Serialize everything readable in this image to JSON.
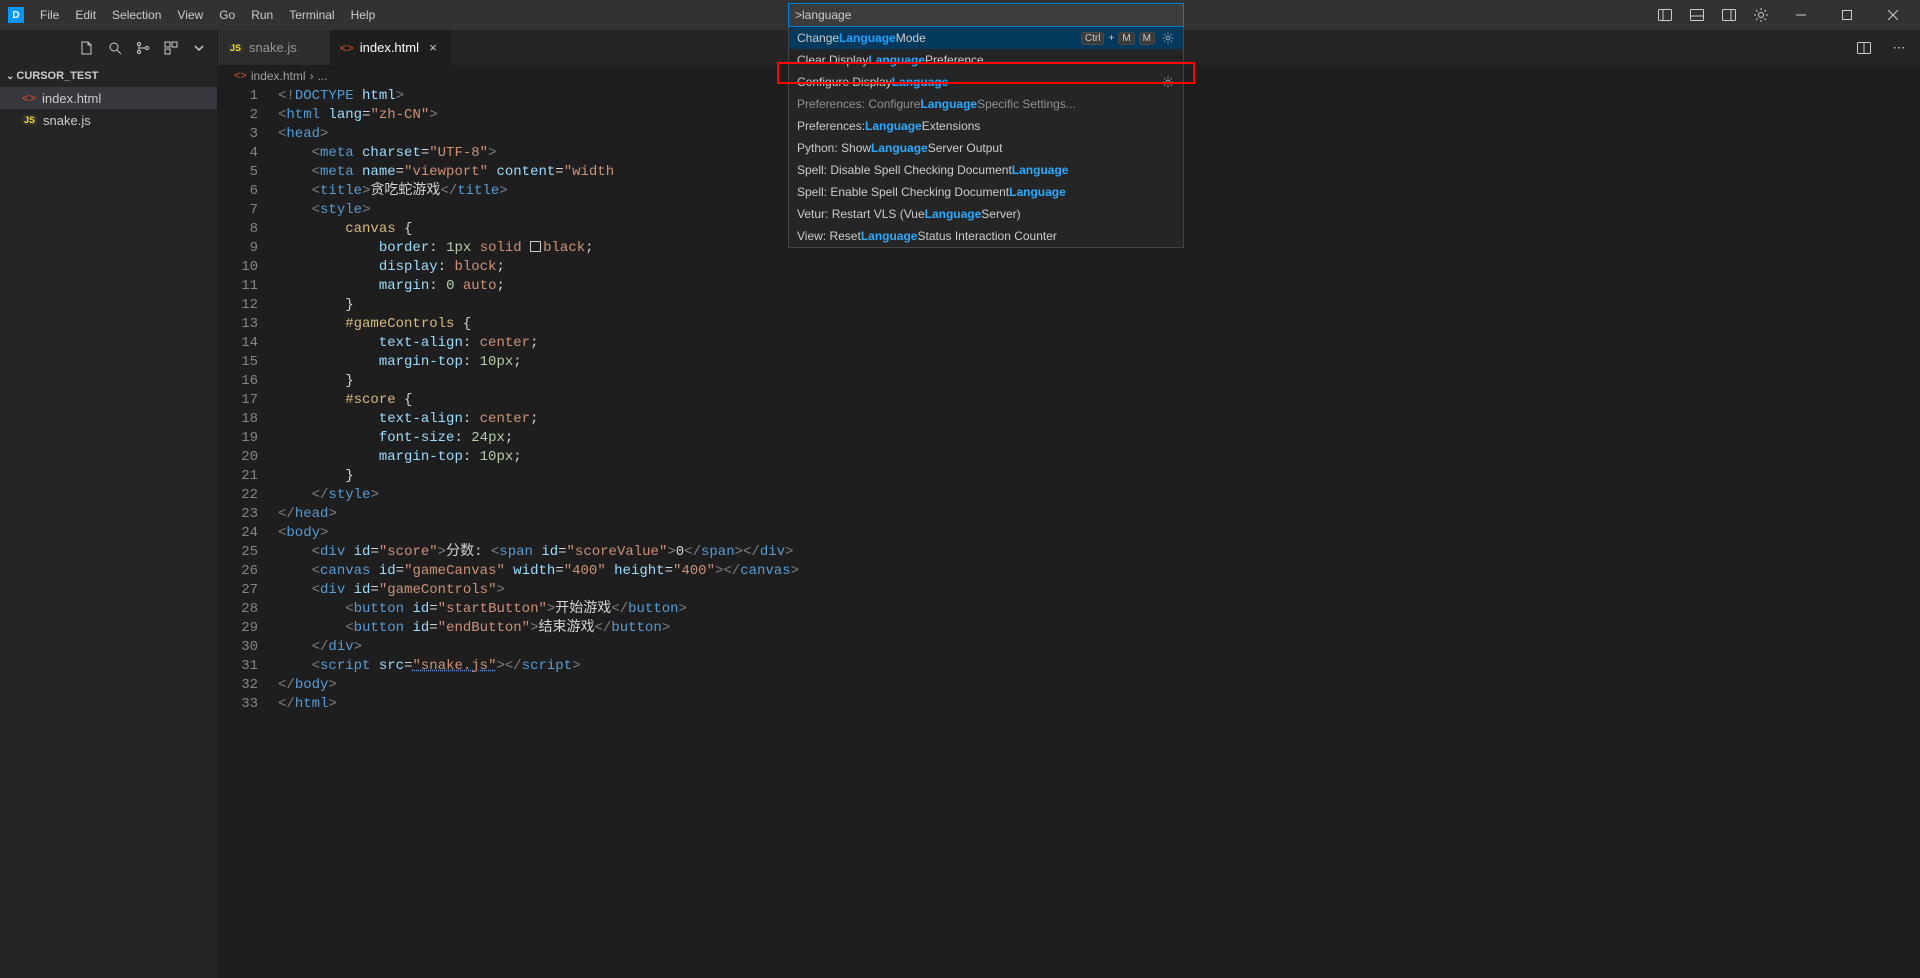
{
  "menu": {
    "items": [
      "File",
      "Edit",
      "Selection",
      "View",
      "Go",
      "Run",
      "Terminal",
      "Help"
    ]
  },
  "sidebar": {
    "folder_name": "CURSOR_TEST",
    "files": [
      {
        "name": "index.html",
        "icon": "html",
        "active": true
      },
      {
        "name": "snake.js",
        "icon": "js",
        "active": false
      }
    ]
  },
  "tabs": [
    {
      "name": "snake.js",
      "icon": "js",
      "active": false
    },
    {
      "name": "index.html",
      "icon": "html",
      "active": true
    }
  ],
  "breadcrumb": {
    "file": "index.html",
    "ellipsis": "..."
  },
  "palette": {
    "input": ">language",
    "items": [
      {
        "pre": "Change ",
        "hl": "Language",
        "post": " Mode",
        "selected": true,
        "kb": [
          "Ctrl",
          "+",
          "M",
          "M"
        ],
        "gear": true
      },
      {
        "pre": "Clear Display ",
        "hl": "Language",
        "post": " Preference",
        "selected": false
      },
      {
        "pre": "Configure Display ",
        "hl": "Language",
        "post": "",
        "selected": false,
        "gear": true,
        "highlighted": true
      },
      {
        "pre": "Preferences: Configure ",
        "hl": "Language",
        "post": " Specific Settings...",
        "selected": false,
        "recently": true
      },
      {
        "pre": "Preferences: ",
        "hl": "Language",
        "post": " Extensions",
        "selected": false
      },
      {
        "pre": "Python: Show ",
        "hl": "Language",
        "post": " Server Output",
        "selected": false
      },
      {
        "pre": "Spell: Disable Spell Checking Document ",
        "hl": "Language",
        "post": "",
        "selected": false
      },
      {
        "pre": "Spell: Enable Spell Checking Document ",
        "hl": "Language",
        "post": "",
        "selected": false
      },
      {
        "pre": "Vetur: Restart VLS (Vue ",
        "hl": "Language",
        "post": " Server)",
        "selected": false
      },
      {
        "pre": "View: Reset ",
        "hl": "Language",
        "post": " Status Interaction Counter",
        "selected": false
      }
    ]
  },
  "code": {
    "lines": [
      [
        {
          "c": "t-punc",
          "t": "<!"
        },
        {
          "c": "t-tag",
          "t": "DOCTYPE"
        },
        {
          "c": "t-text",
          "t": " "
        },
        {
          "c": "t-attr",
          "t": "html"
        },
        {
          "c": "t-punc",
          "t": ">"
        }
      ],
      [
        {
          "c": "t-punc",
          "t": "<"
        },
        {
          "c": "t-tag",
          "t": "html"
        },
        {
          "c": "t-text",
          "t": " "
        },
        {
          "c": "t-attr",
          "t": "lang"
        },
        {
          "c": "t-text",
          "t": "="
        },
        {
          "c": "t-str",
          "t": "\"zh-CN\""
        },
        {
          "c": "t-punc",
          "t": ">"
        }
      ],
      [
        {
          "c": "t-punc",
          "t": "<"
        },
        {
          "c": "t-tag",
          "t": "head"
        },
        {
          "c": "t-punc",
          "t": ">"
        }
      ],
      [
        {
          "c": "t-text",
          "t": "    "
        },
        {
          "c": "t-punc",
          "t": "<"
        },
        {
          "c": "t-tag",
          "t": "meta"
        },
        {
          "c": "t-text",
          "t": " "
        },
        {
          "c": "t-attr",
          "t": "charset"
        },
        {
          "c": "t-text",
          "t": "="
        },
        {
          "c": "t-str",
          "t": "\"UTF-8\""
        },
        {
          "c": "t-punc",
          "t": ">"
        }
      ],
      [
        {
          "c": "t-text",
          "t": "    "
        },
        {
          "c": "t-punc",
          "t": "<"
        },
        {
          "c": "t-tag",
          "t": "meta"
        },
        {
          "c": "t-text",
          "t": " "
        },
        {
          "c": "t-attr",
          "t": "name"
        },
        {
          "c": "t-text",
          "t": "="
        },
        {
          "c": "t-str",
          "t": "\"viewport\""
        },
        {
          "c": "t-text",
          "t": " "
        },
        {
          "c": "t-attr",
          "t": "content"
        },
        {
          "c": "t-text",
          "t": "="
        },
        {
          "c": "t-str",
          "t": "\"width"
        }
      ],
      [
        {
          "c": "t-text",
          "t": "    "
        },
        {
          "c": "t-punc",
          "t": "<"
        },
        {
          "c": "t-tag",
          "t": "title"
        },
        {
          "c": "t-punc",
          "t": ">"
        },
        {
          "c": "t-text",
          "t": "贪吃蛇游戏"
        },
        {
          "c": "t-punc",
          "t": "</"
        },
        {
          "c": "t-tag",
          "t": "title"
        },
        {
          "c": "t-punc",
          "t": ">"
        }
      ],
      [
        {
          "c": "t-text",
          "t": "    "
        },
        {
          "c": "t-punc",
          "t": "<"
        },
        {
          "c": "t-tag",
          "t": "style"
        },
        {
          "c": "t-punc",
          "t": ">"
        }
      ],
      [
        {
          "c": "t-text",
          "t": "        "
        },
        {
          "c": "t-sel",
          "t": "canvas"
        },
        {
          "c": "t-text",
          "t": " {"
        }
      ],
      [
        {
          "c": "t-text",
          "t": "            "
        },
        {
          "c": "t-prop",
          "t": "border"
        },
        {
          "c": "t-text",
          "t": ": "
        },
        {
          "c": "t-num",
          "t": "1px"
        },
        {
          "c": "t-text",
          "t": " "
        },
        {
          "c": "t-val",
          "t": "solid"
        },
        {
          "c": "t-text",
          "t": " "
        },
        {
          "sq": true
        },
        {
          "c": "t-val",
          "t": "black"
        },
        {
          "c": "t-text",
          "t": ";"
        }
      ],
      [
        {
          "c": "t-text",
          "t": "            "
        },
        {
          "c": "t-prop",
          "t": "display"
        },
        {
          "c": "t-text",
          "t": ": "
        },
        {
          "c": "t-val",
          "t": "block"
        },
        {
          "c": "t-text",
          "t": ";"
        }
      ],
      [
        {
          "c": "t-text",
          "t": "            "
        },
        {
          "c": "t-prop",
          "t": "margin"
        },
        {
          "c": "t-text",
          "t": ": "
        },
        {
          "c": "t-num",
          "t": "0"
        },
        {
          "c": "t-text",
          "t": " "
        },
        {
          "c": "t-val",
          "t": "auto"
        },
        {
          "c": "t-text",
          "t": ";"
        }
      ],
      [
        {
          "c": "t-text",
          "t": "        }"
        }
      ],
      [
        {
          "c": "t-text",
          "t": "        "
        },
        {
          "c": "t-sel",
          "t": "#gameControls"
        },
        {
          "c": "t-text",
          "t": " {"
        }
      ],
      [
        {
          "c": "t-text",
          "t": "            "
        },
        {
          "c": "t-prop",
          "t": "text-align"
        },
        {
          "c": "t-text",
          "t": ": "
        },
        {
          "c": "t-val",
          "t": "center"
        },
        {
          "c": "t-text",
          "t": ";"
        }
      ],
      [
        {
          "c": "t-text",
          "t": "            "
        },
        {
          "c": "t-prop",
          "t": "margin-top"
        },
        {
          "c": "t-text",
          "t": ": "
        },
        {
          "c": "t-num",
          "t": "10px"
        },
        {
          "c": "t-text",
          "t": ";"
        }
      ],
      [
        {
          "c": "t-text",
          "t": "        }"
        }
      ],
      [
        {
          "c": "t-text",
          "t": "        "
        },
        {
          "c": "t-sel",
          "t": "#score"
        },
        {
          "c": "t-text",
          "t": " {"
        }
      ],
      [
        {
          "c": "t-text",
          "t": "            "
        },
        {
          "c": "t-prop",
          "t": "text-align"
        },
        {
          "c": "t-text",
          "t": ": "
        },
        {
          "c": "t-val",
          "t": "center"
        },
        {
          "c": "t-text",
          "t": ";"
        }
      ],
      [
        {
          "c": "t-text",
          "t": "            "
        },
        {
          "c": "t-prop",
          "t": "font-size"
        },
        {
          "c": "t-text",
          "t": ": "
        },
        {
          "c": "t-num",
          "t": "24px"
        },
        {
          "c": "t-text",
          "t": ";"
        }
      ],
      [
        {
          "c": "t-text",
          "t": "            "
        },
        {
          "c": "t-prop",
          "t": "margin-top"
        },
        {
          "c": "t-text",
          "t": ": "
        },
        {
          "c": "t-num",
          "t": "10px"
        },
        {
          "c": "t-text",
          "t": ";"
        }
      ],
      [
        {
          "c": "t-text",
          "t": "        }"
        }
      ],
      [
        {
          "c": "t-text",
          "t": "    "
        },
        {
          "c": "t-punc",
          "t": "</"
        },
        {
          "c": "t-tag",
          "t": "style"
        },
        {
          "c": "t-punc",
          "t": ">"
        }
      ],
      [
        {
          "c": "t-punc",
          "t": "</"
        },
        {
          "c": "t-tag",
          "t": "head"
        },
        {
          "c": "t-punc",
          "t": ">"
        }
      ],
      [
        {
          "c": "t-punc",
          "t": "<"
        },
        {
          "c": "t-tag",
          "t": "body"
        },
        {
          "c": "t-punc",
          "t": ">"
        }
      ],
      [
        {
          "c": "t-text",
          "t": "    "
        },
        {
          "c": "t-punc",
          "t": "<"
        },
        {
          "c": "t-tag",
          "t": "div"
        },
        {
          "c": "t-text",
          "t": " "
        },
        {
          "c": "t-attr",
          "t": "id"
        },
        {
          "c": "t-text",
          "t": "="
        },
        {
          "c": "t-str",
          "t": "\"score\""
        },
        {
          "c": "t-punc",
          "t": ">"
        },
        {
          "c": "t-text",
          "t": "分数: "
        },
        {
          "c": "t-punc",
          "t": "<"
        },
        {
          "c": "t-tag",
          "t": "span"
        },
        {
          "c": "t-text",
          "t": " "
        },
        {
          "c": "t-attr",
          "t": "id"
        },
        {
          "c": "t-text",
          "t": "="
        },
        {
          "c": "t-str",
          "t": "\"scoreValue\""
        },
        {
          "c": "t-punc",
          "t": ">"
        },
        {
          "c": "t-text",
          "t": "0"
        },
        {
          "c": "t-punc",
          "t": "</"
        },
        {
          "c": "t-tag",
          "t": "span"
        },
        {
          "c": "t-punc",
          "t": "></"
        },
        {
          "c": "t-tag",
          "t": "div"
        },
        {
          "c": "t-punc",
          "t": ">"
        }
      ],
      [
        {
          "c": "t-text",
          "t": "    "
        },
        {
          "c": "t-punc",
          "t": "<"
        },
        {
          "c": "t-tag",
          "t": "canvas"
        },
        {
          "c": "t-text",
          "t": " "
        },
        {
          "c": "t-attr",
          "t": "id"
        },
        {
          "c": "t-text",
          "t": "="
        },
        {
          "c": "t-str",
          "t": "\"gameCanvas\""
        },
        {
          "c": "t-text",
          "t": " "
        },
        {
          "c": "t-attr",
          "t": "width"
        },
        {
          "c": "t-text",
          "t": "="
        },
        {
          "c": "t-str",
          "t": "\"400\""
        },
        {
          "c": "t-text",
          "t": " "
        },
        {
          "c": "t-attr",
          "t": "height"
        },
        {
          "c": "t-text",
          "t": "="
        },
        {
          "c": "t-str",
          "t": "\"400\""
        },
        {
          "c": "t-punc",
          "t": "></"
        },
        {
          "c": "t-tag",
          "t": "canvas"
        },
        {
          "c": "t-punc",
          "t": ">"
        }
      ],
      [
        {
          "c": "t-text",
          "t": "    "
        },
        {
          "c": "t-punc",
          "t": "<"
        },
        {
          "c": "t-tag",
          "t": "div"
        },
        {
          "c": "t-text",
          "t": " "
        },
        {
          "c": "t-attr",
          "t": "id"
        },
        {
          "c": "t-text",
          "t": "="
        },
        {
          "c": "t-str",
          "t": "\"gameControls\""
        },
        {
          "c": "t-punc",
          "t": ">"
        }
      ],
      [
        {
          "c": "t-text",
          "t": "        "
        },
        {
          "c": "t-punc",
          "t": "<"
        },
        {
          "c": "t-tag",
          "t": "button"
        },
        {
          "c": "t-text",
          "t": " "
        },
        {
          "c": "t-attr",
          "t": "id"
        },
        {
          "c": "t-text",
          "t": "="
        },
        {
          "c": "t-str",
          "t": "\"startButton\""
        },
        {
          "c": "t-punc",
          "t": ">"
        },
        {
          "c": "t-text",
          "t": "开始游戏"
        },
        {
          "c": "t-punc",
          "t": "</"
        },
        {
          "c": "t-tag",
          "t": "button"
        },
        {
          "c": "t-punc",
          "t": ">"
        }
      ],
      [
        {
          "c": "t-text",
          "t": "        "
        },
        {
          "c": "t-punc",
          "t": "<"
        },
        {
          "c": "t-tag",
          "t": "button"
        },
        {
          "c": "t-text",
          "t": " "
        },
        {
          "c": "t-attr",
          "t": "id"
        },
        {
          "c": "t-text",
          "t": "="
        },
        {
          "c": "t-str",
          "t": "\"endButton\""
        },
        {
          "c": "t-punc",
          "t": ">"
        },
        {
          "c": "t-text",
          "t": "结束游戏"
        },
        {
          "c": "t-punc",
          "t": "</"
        },
        {
          "c": "t-tag",
          "t": "button"
        },
        {
          "c": "t-punc",
          "t": ">"
        }
      ],
      [
        {
          "c": "t-text",
          "t": "    "
        },
        {
          "c": "t-punc",
          "t": "</"
        },
        {
          "c": "t-tag",
          "t": "div"
        },
        {
          "c": "t-punc",
          "t": ">"
        }
      ],
      [
        {
          "c": "t-text",
          "t": "    "
        },
        {
          "c": "t-punc",
          "t": "<"
        },
        {
          "c": "t-tag",
          "t": "script"
        },
        {
          "c": "t-text",
          "t": " "
        },
        {
          "c": "t-attr",
          "t": "src"
        },
        {
          "c": "t-text",
          "t": "="
        },
        {
          "c": "t-str t-underline",
          "t": "\"snake.js\""
        },
        {
          "c": "t-punc",
          "t": "></"
        },
        {
          "c": "t-tag",
          "t": "script"
        },
        {
          "c": "t-punc",
          "t": ">"
        }
      ],
      [
        {
          "c": "t-punc",
          "t": "</"
        },
        {
          "c": "t-tag",
          "t": "body"
        },
        {
          "c": "t-punc",
          "t": ">"
        }
      ],
      [
        {
          "c": "t-punc",
          "t": "</"
        },
        {
          "c": "t-tag",
          "t": "html"
        },
        {
          "c": "t-punc",
          "t": ">"
        }
      ]
    ]
  }
}
